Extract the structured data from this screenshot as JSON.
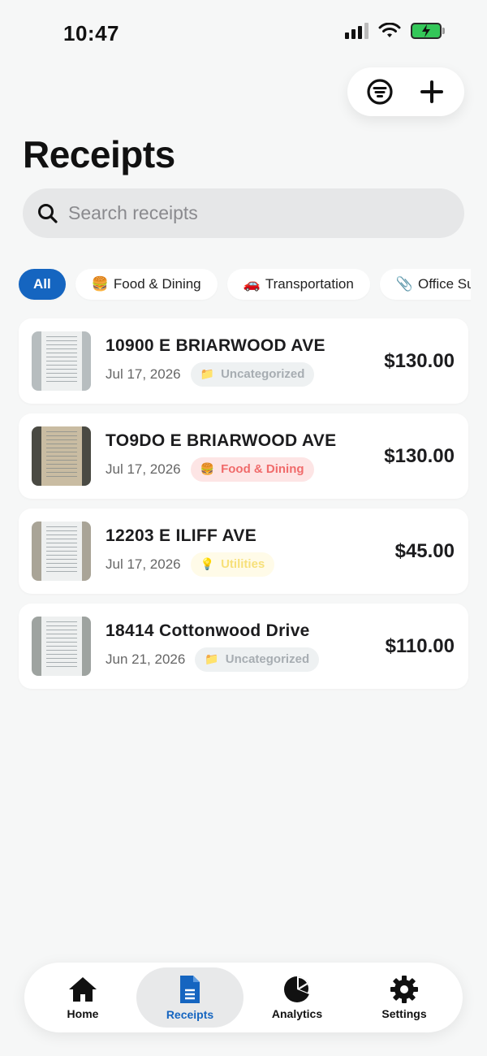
{
  "status": {
    "time": "10:47"
  },
  "header": {
    "title": "Receipts"
  },
  "search": {
    "placeholder": "Search receipts",
    "value": ""
  },
  "filters": [
    {
      "label": "All",
      "emoji": "",
      "active": true
    },
    {
      "label": "Food & Dining",
      "emoji": "🍔",
      "active": false
    },
    {
      "label": "Transportation",
      "emoji": "🚗",
      "active": false
    },
    {
      "label": "Office Supplies",
      "emoji": "📎",
      "active": false
    }
  ],
  "receipts": [
    {
      "store": "10900 E BRIARWOOD AVE",
      "date": "Jul 17, 2026",
      "category": "Uncategorized",
      "category_emoji": "📁",
      "amount": "$130.00",
      "badge_bg": "#eef1f2",
      "badge_fg": "#a7adb2",
      "thumb_bg": "#b7bdbf"
    },
    {
      "store": "TO9DO E BRIARWOOD AVE",
      "date": "Jul 17, 2026",
      "category": "Food & Dining",
      "category_emoji": "🍔",
      "amount": "$130.00",
      "badge_bg": "#fde5e5",
      "badge_fg": "#f06b6b",
      "thumb_bg": "#4a4a43"
    },
    {
      "store": "12203 E ILIFF AVE",
      "date": "Jul 17, 2026",
      "category": "Utilities",
      "category_emoji": "💡",
      "amount": "$45.00",
      "badge_bg": "#fffbe8",
      "badge_fg": "#f7e07a",
      "thumb_bg": "#a9a497"
    },
    {
      "store": "18414 Cottonwood Drive",
      "date": "Jun 21, 2026",
      "category": "Uncategorized",
      "category_emoji": "📁",
      "amount": "$110.00",
      "badge_bg": "#eef1f2",
      "badge_fg": "#a7adb2",
      "thumb_bg": "#9ea3a0"
    }
  ],
  "tabs": [
    {
      "label": "Home",
      "icon": "home-icon",
      "active": false
    },
    {
      "label": "Receipts",
      "icon": "receipt-icon",
      "active": true
    },
    {
      "label": "Analytics",
      "icon": "pie-chart-icon",
      "active": false
    },
    {
      "label": "Settings",
      "icon": "gear-icon",
      "active": false
    }
  ],
  "colors": {
    "accent": "#1565c0",
    "background": "#f6f7f7"
  }
}
